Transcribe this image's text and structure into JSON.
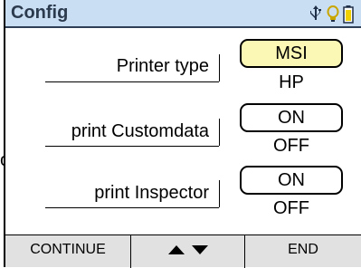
{
  "header": {
    "title": "Config",
    "icons": [
      "usb-icon",
      "bulb-icon",
      "battery-icon"
    ]
  },
  "settings": [
    {
      "label": "Printer type",
      "option_top": "MSI",
      "option_bottom": "HP",
      "selected": "MSI"
    },
    {
      "label": "print Customdata",
      "option_top": "ON",
      "option_bottom": "OFF",
      "selected": "ON"
    },
    {
      "label": "print Inspector",
      "option_top": "ON",
      "option_bottom": "OFF",
      "selected": "ON"
    }
  ],
  "edge_fragment": "o.",
  "softkeys": {
    "left": "CONTINUE",
    "middle_icon": "up-down-arrows-icon",
    "right": "END"
  },
  "colors": {
    "title_bar_bg": "#c9def3",
    "title_text": "#2c3a4e",
    "selected_bg": "#fbf7b5",
    "softkey_bg": "#e1e1e1"
  }
}
